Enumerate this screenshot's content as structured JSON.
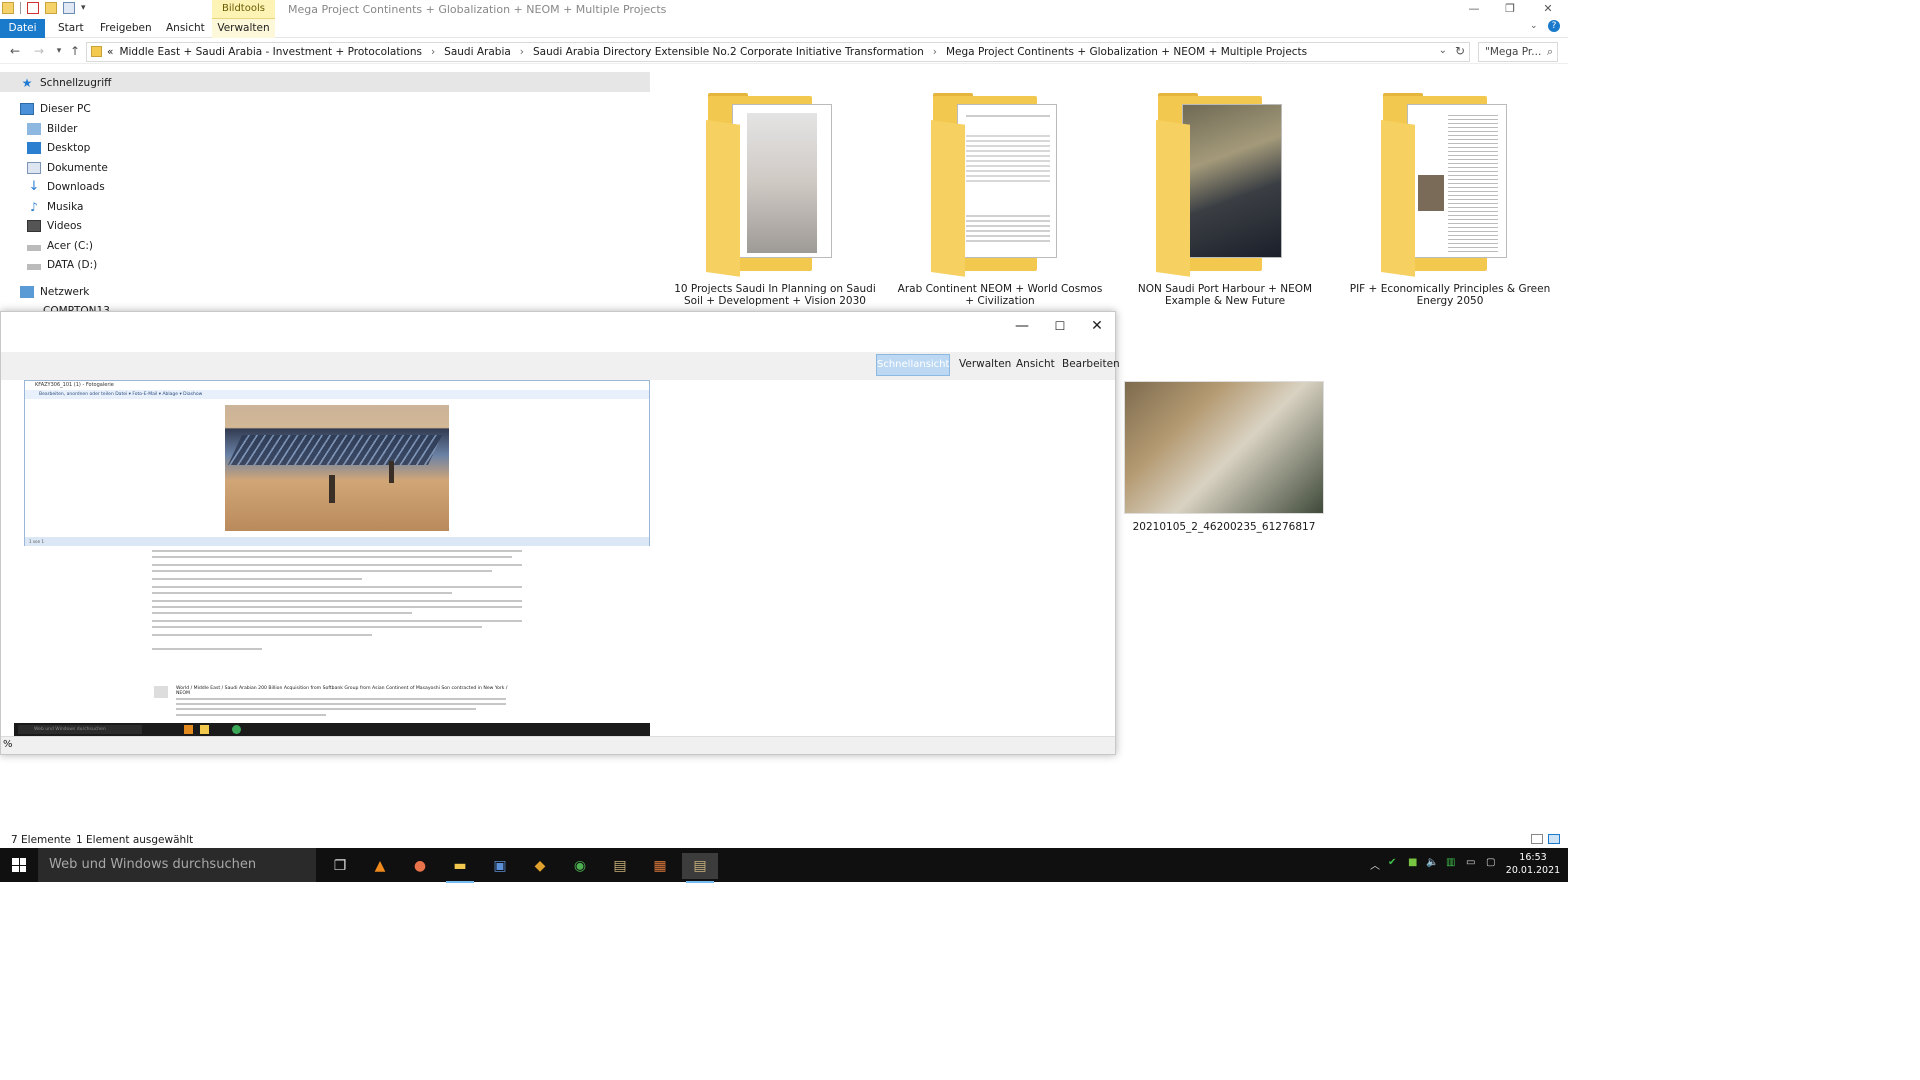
{
  "explorer": {
    "context_tab": "Bildtools",
    "window_title": "Mega Project Continents + Globalization + NEOM + Multiple Projects",
    "ribbon_tabs": [
      "Datei",
      "Start",
      "Freigeben",
      "Ansicht",
      "Verwalten"
    ],
    "breadcrumb": [
      "Middle East + Saudi Arabia - Investment + Protocolations",
      "Saudi Arabia",
      "Saudi Arabia Directory Extensible No.2  Corporate Initiative Transformation",
      "Mega Project Continents + Globalization + NEOM + Multiple Projects"
    ],
    "breadcrumb_prefix": "«",
    "search_placeholder": "\"Mega Pr...",
    "nav": {
      "quick_access": "Schnellzugriff",
      "this_pc": "Dieser PC",
      "items": [
        "Bilder",
        "Desktop",
        "Dokumente",
        "Downloads",
        "Musika",
        "Videos",
        "Acer (C:)",
        "DATA (D:)"
      ],
      "network": "Netzwerk",
      "network_child": "COMPTON13"
    },
    "files": [
      {
        "name": "10 Projects Saudi In Planning on Saudi Soil + Development + Vision 2030"
      },
      {
        "name": "Arab Continent NEOM + World Cosmos + Civilization"
      },
      {
        "name": "NON Saudi Port Harbour + NEOM Example & New Future"
      },
      {
        "name": "PIF + Economically Principles & Green Energy 2050"
      }
    ],
    "photo_file": "20210105_2_46200235_61276817",
    "status": {
      "count": "7 Elemente",
      "selected": "1 Element ausgewählt"
    }
  },
  "viewer": {
    "tabs": [
      "Schnellansicht",
      "Verwalten",
      "Ansicht",
      "Bearbeiten"
    ],
    "footer_left": "%",
    "inner": {
      "title": "KFAZY306_101 (1) - Fotogalerie",
      "menu": "Bearbeiten, anordnen oder teilen     Datei ▾     Foto-E-Mail ▾     Ablage ▾     Diashow",
      "status": "1 von 1",
      "heading": "World / Middle East / Saudi Arabian 200 Billion Acquisition from Softbank Group from Asian Continent of Masayoshi Son contracted in New York / NEOM",
      "taskbar_search": "Web und Windows durchsuchen"
    }
  },
  "taskbar": {
    "search": "Web und Windows durchsuchen",
    "time": "16:53",
    "date": "20.01.2021"
  },
  "colors": {
    "accent": "#1979ca",
    "folder": "#f3c84e",
    "taskbar": "#101010"
  }
}
